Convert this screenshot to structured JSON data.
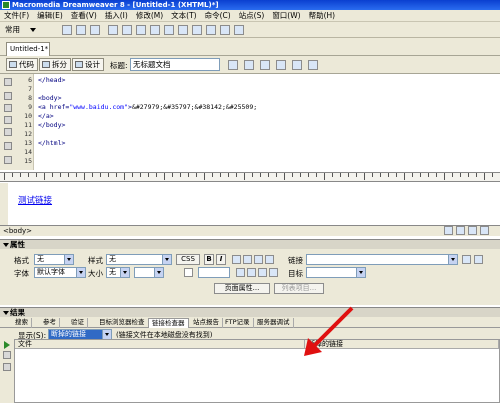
{
  "window": {
    "title": "Macromedia Dreamweaver 8 - [Untitled-1 (XHTML)*]"
  },
  "menu": [
    "文件(F)",
    "编辑(E)",
    "查看(V)",
    "插入(I)",
    "修改(M)",
    "文本(T)",
    "命令(C)",
    "站点(S)",
    "窗口(W)",
    "帮助(H)"
  ],
  "insert_bar": {
    "category": "常用"
  },
  "document": {
    "tab": "Untitled-1*",
    "views": [
      "代码",
      "拆分",
      "设计"
    ],
    "title_label": "标题:",
    "title_value": "无标题文档"
  },
  "code": {
    "lines": [
      {
        "no": "6",
        "parts": [
          {
            "t": "   </head>",
            "c": "tag"
          }
        ]
      },
      {
        "no": "7",
        "parts": [
          {
            "t": "",
            "c": ""
          }
        ]
      },
      {
        "no": "8",
        "parts": [
          {
            "t": "   <body>",
            "c": "tag"
          }
        ]
      },
      {
        "no": "9",
        "parts": [
          {
            "t": "   <a href=",
            "c": "tag"
          },
          {
            "t": "\"www.baidu.com\"",
            "c": "str"
          },
          {
            "t": ">",
            "c": "tag"
          },
          {
            "t": "&#27979;&#35797;&#38142;&#25509;",
            "c": ""
          }
        ]
      },
      {
        "no": "10",
        "parts": [
          {
            "t": "   </a>",
            "c": "tag"
          }
        ]
      },
      {
        "no": "11",
        "parts": [
          {
            "t": "   </body>",
            "c": "tag"
          }
        ]
      },
      {
        "no": "12",
        "parts": [
          {
            "t": "",
            "c": ""
          }
        ]
      },
      {
        "no": "13",
        "parts": [
          {
            "t": "   </html>",
            "c": "tag"
          }
        ]
      },
      {
        "no": "14",
        "parts": [
          {
            "t": "",
            "c": ""
          }
        ]
      },
      {
        "no": "15",
        "parts": [
          {
            "t": "",
            "c": ""
          }
        ]
      }
    ]
  },
  "design": {
    "link_text": "测试链接"
  },
  "status": {
    "tag": "<body>"
  },
  "properties": {
    "header": "属性",
    "format_label": "格式",
    "format_value": "无",
    "style_label": "样式",
    "style_value": "无",
    "css_button": "CSS",
    "bold": "B",
    "italic": "I",
    "link_label": "链接",
    "font_label": "字体",
    "font_value": "默认字体",
    "size_label": "大小",
    "size_value": "无",
    "target_label": "目标",
    "page_props_button": "页面属性...",
    "list_item_button": "列表项目..."
  },
  "results": {
    "header": "结果",
    "tabs": [
      "搜索",
      "参考",
      "验证",
      "目标浏览器检查",
      "链接检查器",
      "站点报告",
      "FTP记录",
      "服务器调试"
    ],
    "active_tab": 4,
    "show_label": "显示(S):",
    "show_value": "断掉的链接",
    "show_note": "(链接文件在本地磁盘没有找到)",
    "col_file": "文件",
    "col_broken": "断掉的链接"
  },
  "colors": {
    "titlebar": "#0a3fd0",
    "chrome": "#ece9d8",
    "link": "#0000ee",
    "arrow": "#e01010"
  }
}
